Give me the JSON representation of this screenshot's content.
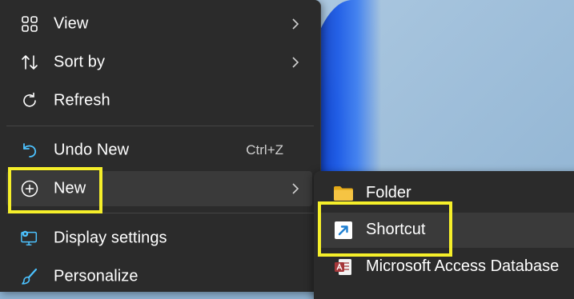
{
  "colors": {
    "menu_bg": "#2b2b2b",
    "hover_bg": "#3a3a3a",
    "text": "#ffffff",
    "accent_icon": "#4cc2ff",
    "highlight": "#f5ef2a"
  },
  "menu": {
    "items": [
      {
        "label": "View",
        "icon": "grid-icon",
        "has_submenu": true
      },
      {
        "label": "Sort by",
        "icon": "sort-icon",
        "has_submenu": true
      },
      {
        "label": "Refresh",
        "icon": "refresh-icon",
        "has_submenu": false
      },
      {
        "label": "Undo New",
        "icon": "undo-icon",
        "shortcut": "Ctrl+Z",
        "has_submenu": false
      },
      {
        "label": "New",
        "icon": "add-circle-icon",
        "has_submenu": true
      },
      {
        "label": "Display settings",
        "icon": "display-settings-icon",
        "has_submenu": false
      },
      {
        "label": "Personalize",
        "icon": "brush-icon",
        "has_submenu": false
      }
    ]
  },
  "submenu": {
    "items": [
      {
        "label": "Folder",
        "icon": "folder-icon"
      },
      {
        "label": "Shortcut",
        "icon": "shortcut-icon"
      },
      {
        "label": "Microsoft Access Database",
        "icon": "access-icon"
      }
    ]
  }
}
